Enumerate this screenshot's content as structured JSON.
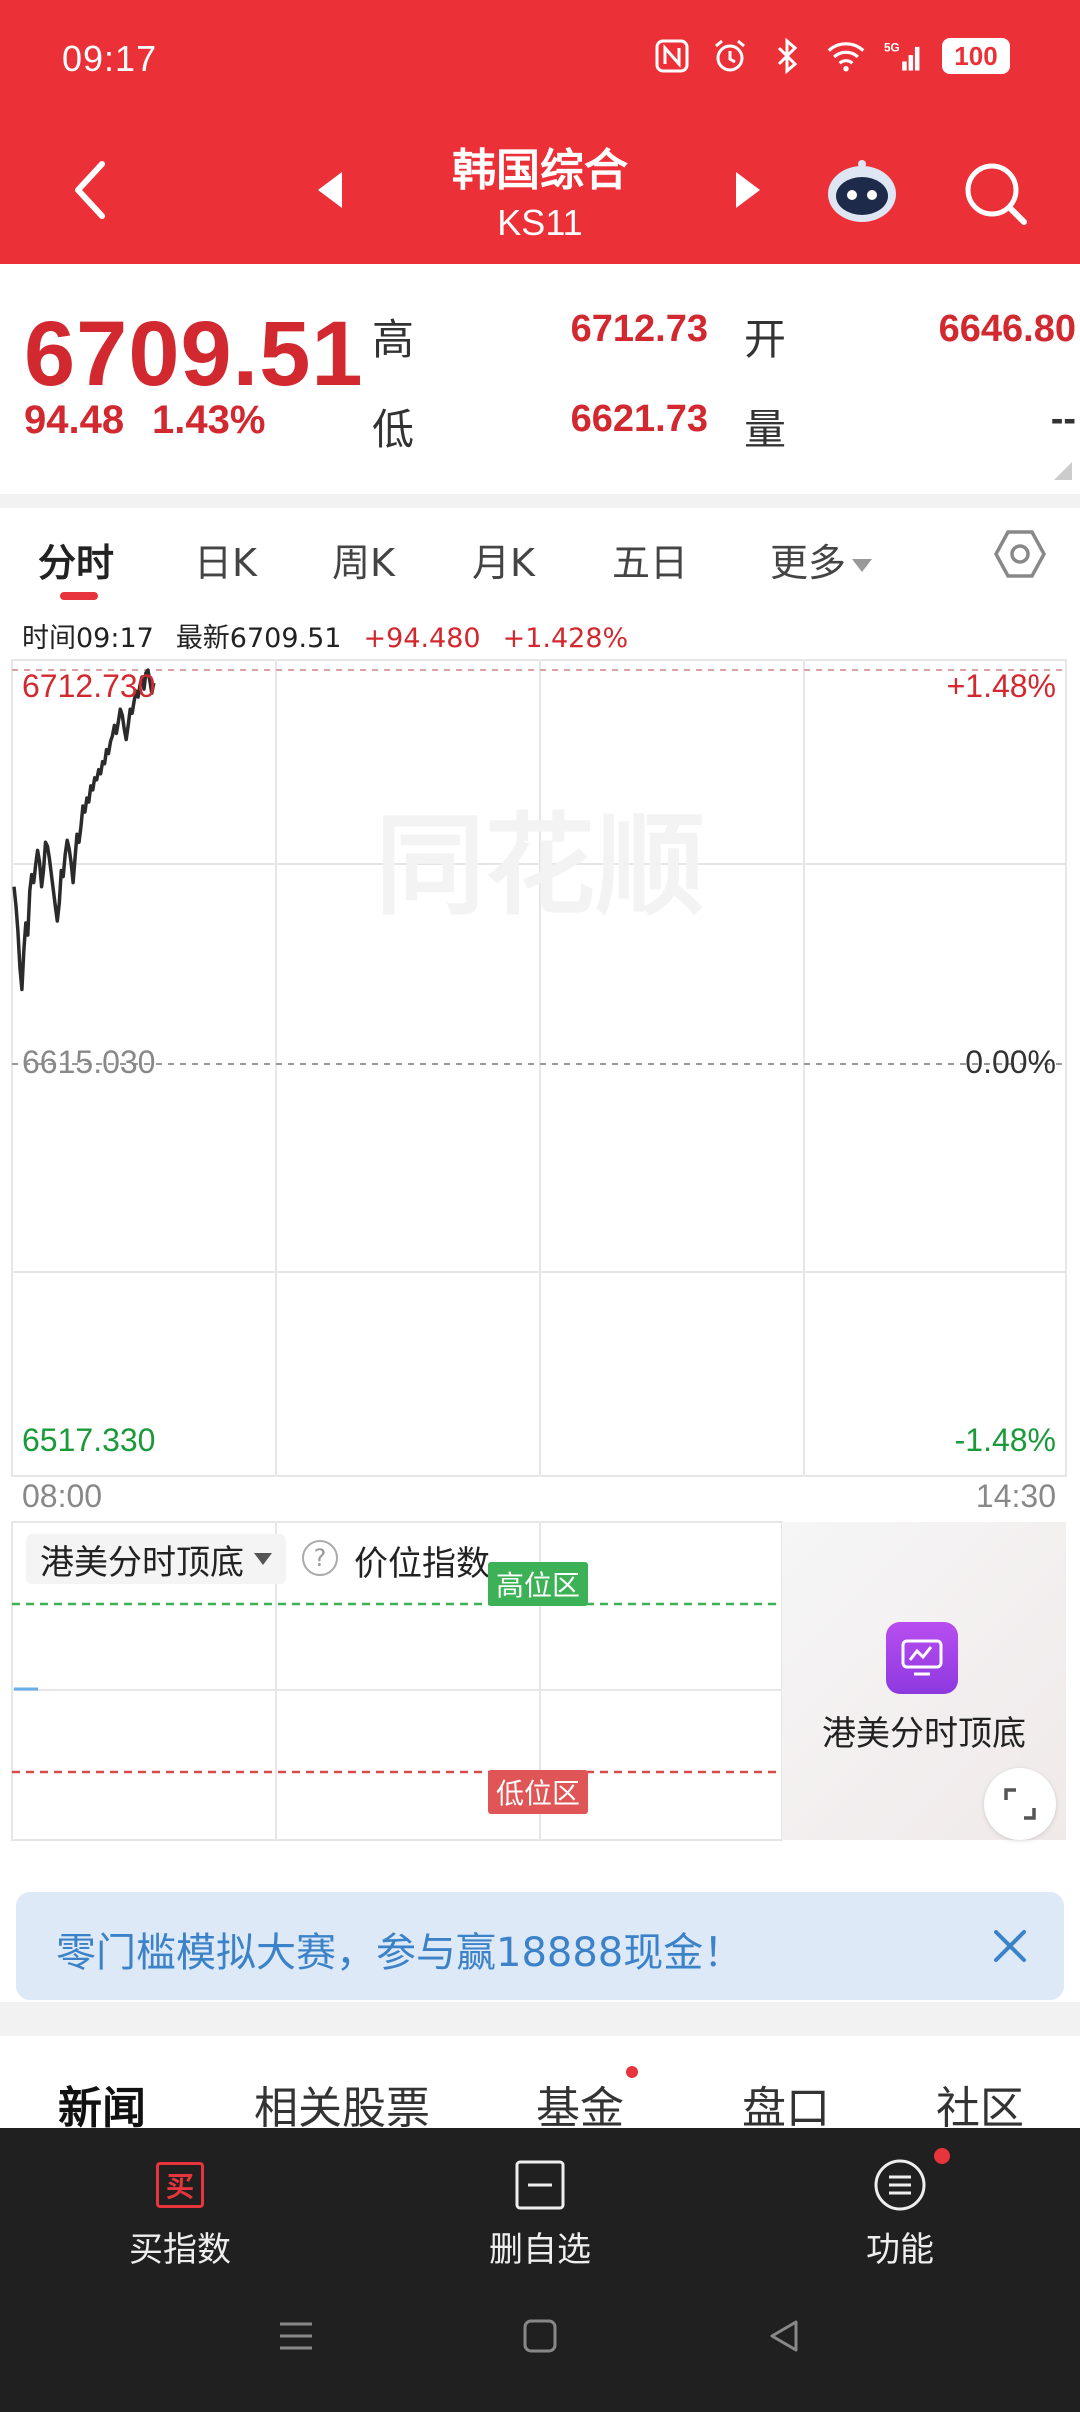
{
  "status_bar": {
    "time": "09:17",
    "battery": "100",
    "network": "5G"
  },
  "header": {
    "title": "韩国综合",
    "code": "KS11"
  },
  "quote": {
    "price": "6709.51",
    "change": "94.48",
    "change_pct": "1.43%",
    "high_label": "高",
    "high": "6712.73",
    "low_label": "低",
    "low": "6621.73",
    "open_label": "开",
    "open": "6646.80",
    "volume_label": "量",
    "volume": "--"
  },
  "tabs": [
    "分时",
    "日K",
    "周K",
    "月K",
    "五日",
    "更多"
  ],
  "chart_info": {
    "time": "时间09:17",
    "latest": "最新6709.51",
    "change": "+94.480",
    "change_pct": "+1.428%"
  },
  "chart_data": {
    "type": "line",
    "x_start_label": "08:00",
    "x_end_label": "14:30",
    "ylim": [
      6517.33,
      6712.73
    ],
    "prev_close": 6615.03,
    "y_labels": {
      "top": "6712.730",
      "mid": "6615.030",
      "bottom": "6517.330"
    },
    "pct_labels": {
      "top": "+1.48%",
      "mid": "0.00%",
      "bottom": "-1.48%"
    },
    "series": [
      {
        "values": [
          6659.0,
          6654.2,
          6648.0,
          6639.0,
          6633.5,
          6643.0,
          6650.0,
          6647.0,
          6658.0,
          6662.0,
          6660.0,
          6664.5,
          6668.0,
          6665.0,
          6659.0,
          6663.0,
          6670.0,
          6669.0,
          6666.0,
          6662.0,
          6658.0,
          6654.0,
          6650.5,
          6655.0,
          6663.0,
          6661.5,
          6667.0,
          6670.5,
          6668.5,
          6665.0,
          6660.0,
          6666.0,
          6672.0,
          6670.0,
          6674.0,
          6679.0,
          6677.5,
          6681.0,
          6680.0,
          6684.0,
          6683.0,
          6686.0,
          6685.5,
          6688.0,
          6687.0,
          6690.0,
          6689.5,
          6693.0,
          6692.0,
          6695.0,
          6696.5,
          6699.0,
          6697.0,
          6700.0,
          6703.0,
          6701.5,
          6698.0,
          6695.5,
          6699.0,
          6703.0,
          6702.0,
          6705.0,
          6707.5,
          6706.0,
          6709.0,
          6711.0,
          6708.0,
          6712.0,
          6712.7,
          6710.0,
          6707.0,
          6709.5
        ]
      }
    ],
    "total_points": 391
  },
  "indicator": {
    "name": "港美分时顶底",
    "value": "价位指数--",
    "high_zone": "高位区",
    "low_zone": "低位区"
  },
  "promo_side": {
    "label": "港美分时顶底"
  },
  "banner": {
    "text": "零门槛模拟大赛，参与赢18888现金！"
  },
  "news_tabs": [
    "新闻",
    "相关股票",
    "基金",
    "盘口",
    "社区"
  ],
  "bottom_bar": [
    {
      "label": "买指数",
      "icon": "买"
    },
    {
      "label": "删自选"
    },
    {
      "label": "功能"
    }
  ],
  "icons": [
    "nfc-icon",
    "alarm-icon",
    "bluetooth-icon",
    "wifi-icon",
    "signal-icon"
  ]
}
